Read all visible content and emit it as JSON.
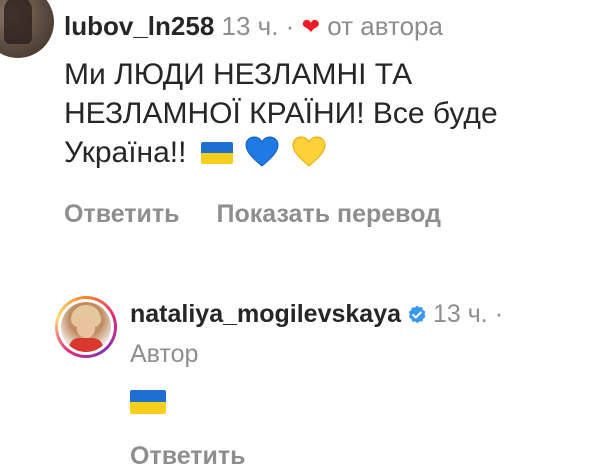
{
  "comment": {
    "username": "lubov_ln258",
    "time": "13 ч.",
    "separator": "·",
    "liked_by_author": "от автора",
    "text_lines": [
      "Ми ЛЮДИ НЕЗЛАМНІ ТА",
      "НЕЗЛАМНОЇ  КРАЇНИ! Все буде",
      "Україна!!"
    ],
    "emojis": [
      "ukraine-flag",
      "blue-heart",
      "yellow-heart"
    ],
    "actions": {
      "reply": "Ответить",
      "translate": "Показать перевод"
    }
  },
  "reply": {
    "username": "nataliya_mogilevskaya",
    "verified": true,
    "time": "13 ч.",
    "separator": "·",
    "author_label": "Автор",
    "emojis": [
      "ukraine-flag"
    ],
    "action_partial": "Ответить"
  },
  "colors": {
    "text": "#262626",
    "muted": "#8e8e8e",
    "heart": "#ed1c24",
    "verified": "#3897f0",
    "flag_blue": "#1f6fd1",
    "flag_yellow": "#f5cf1c"
  }
}
